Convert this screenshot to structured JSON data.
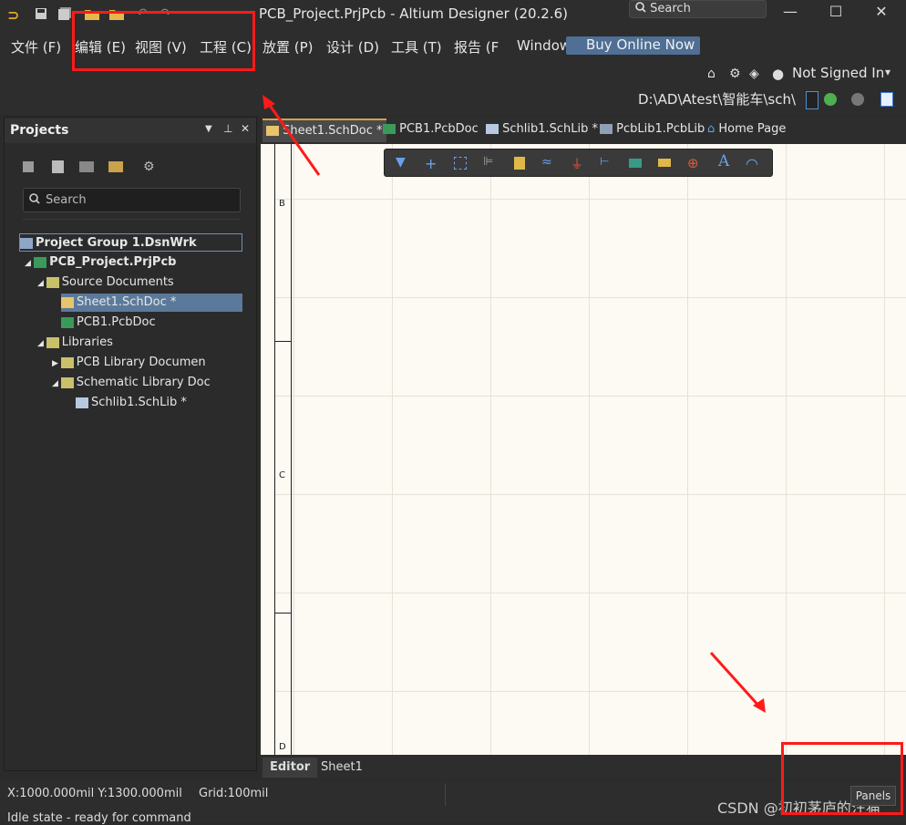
{
  "titlebar": {
    "title": "PCB_Project.PrjPcb - Altium Designer (20.2.6)",
    "search_label": "Search",
    "minimize": "—",
    "maximize": "☐",
    "close": "✕"
  },
  "menubar": {
    "items": [
      "文件 (F)",
      "编辑 (E)",
      "视图 (V)",
      "工程 (C)",
      "放置 (P)",
      "设计 (D)",
      "工具 (T)",
      "报告 (F",
      "Window"
    ],
    "buy_label": "Buy Online Now"
  },
  "toolrow": {
    "signed_label": "Not Signed In",
    "path": "D:\\AD\\Atest\\智能车\\sch\\"
  },
  "projects_panel": {
    "title": "Projects",
    "search_placeholder": "Search",
    "tree": [
      {
        "label": "Project Group 1.DsnWrk",
        "level": 0
      },
      {
        "label": "PCB_Project.PrjPcb",
        "level": 1
      },
      {
        "label": "Source Documents",
        "level": 2
      },
      {
        "label": "Sheet1.SchDoc *",
        "level": 3,
        "selected": true
      },
      {
        "label": "PCB1.PcbDoc",
        "level": 3
      },
      {
        "label": "Libraries",
        "level": 2
      },
      {
        "label": "PCB Library Documen",
        "level": 3
      },
      {
        "label": "Schematic Library Doc",
        "level": 3
      },
      {
        "label": "Schlib1.SchLib *",
        "level": 4
      }
    ]
  },
  "doc_tabs": [
    "Sheet1.SchDoc *",
    "PCB1.PcbDoc",
    "Schlib1.SchLib *",
    "PcbLib1.PcbLib",
    "Home Page"
  ],
  "sheet": {
    "zone_labels": [
      "B",
      "C",
      "D"
    ]
  },
  "editor_tabs": [
    "Editor",
    "Sheet1"
  ],
  "status": {
    "coords": "X:1000.000mil Y:1300.000mil",
    "grid": "Grid:100mil",
    "idle": "Idle state - ready for command",
    "panels_label": "Panels"
  },
  "watermark": "CSDN @初初茅庐的汪猫",
  "colors": {
    "accent": "#4f6f95",
    "selection": "#5b7a9b",
    "annotation": "#ff1a1a"
  }
}
